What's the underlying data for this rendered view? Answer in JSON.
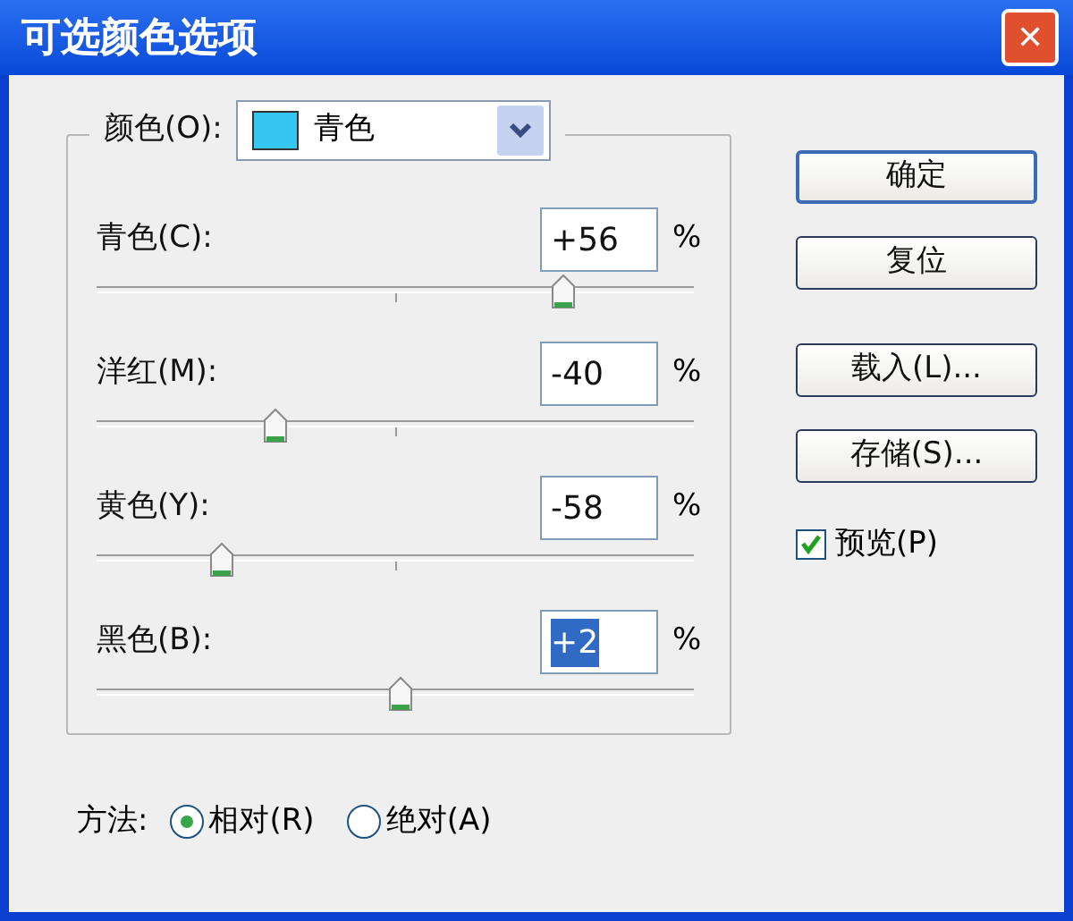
{
  "window": {
    "title": "可选颜色选项",
    "close": "✕"
  },
  "colors": {
    "label": "颜色(O):",
    "value": "青色",
    "color": "#33c6f0"
  },
  "channels": [
    {
      "label": "青色(C):",
      "value": "+56",
      "unit": "%",
      "level": 0.78,
      "text_selected": false
    },
    {
      "label": "洋红(M):",
      "value": "-40",
      "unit": "%",
      "level": 0.3,
      "text_selected": false
    },
    {
      "label": "黄色(Y):",
      "value": "-58",
      "unit": "%",
      "level": 0.21,
      "text_selected": false
    },
    {
      "label": "黑色(B):",
      "value": "+2",
      "unit": "%",
      "level": 0.51,
      "text_selected": true
    }
  ],
  "buttons": [
    {
      "label": "确定",
      "default": true
    },
    {
      "label": "复位",
      "default": false
    },
    {
      "label": "载入(L)...",
      "default": false
    },
    {
      "label": "存储(S)...",
      "default": false
    }
  ],
  "preview": {
    "label": "预览(P)",
    "checked": true
  },
  "method": {
    "label": "方法:",
    "options": [
      {
        "label": "相对(R)",
        "selected": true
      },
      {
        "label": "绝对(A)",
        "selected": false
      }
    ]
  }
}
